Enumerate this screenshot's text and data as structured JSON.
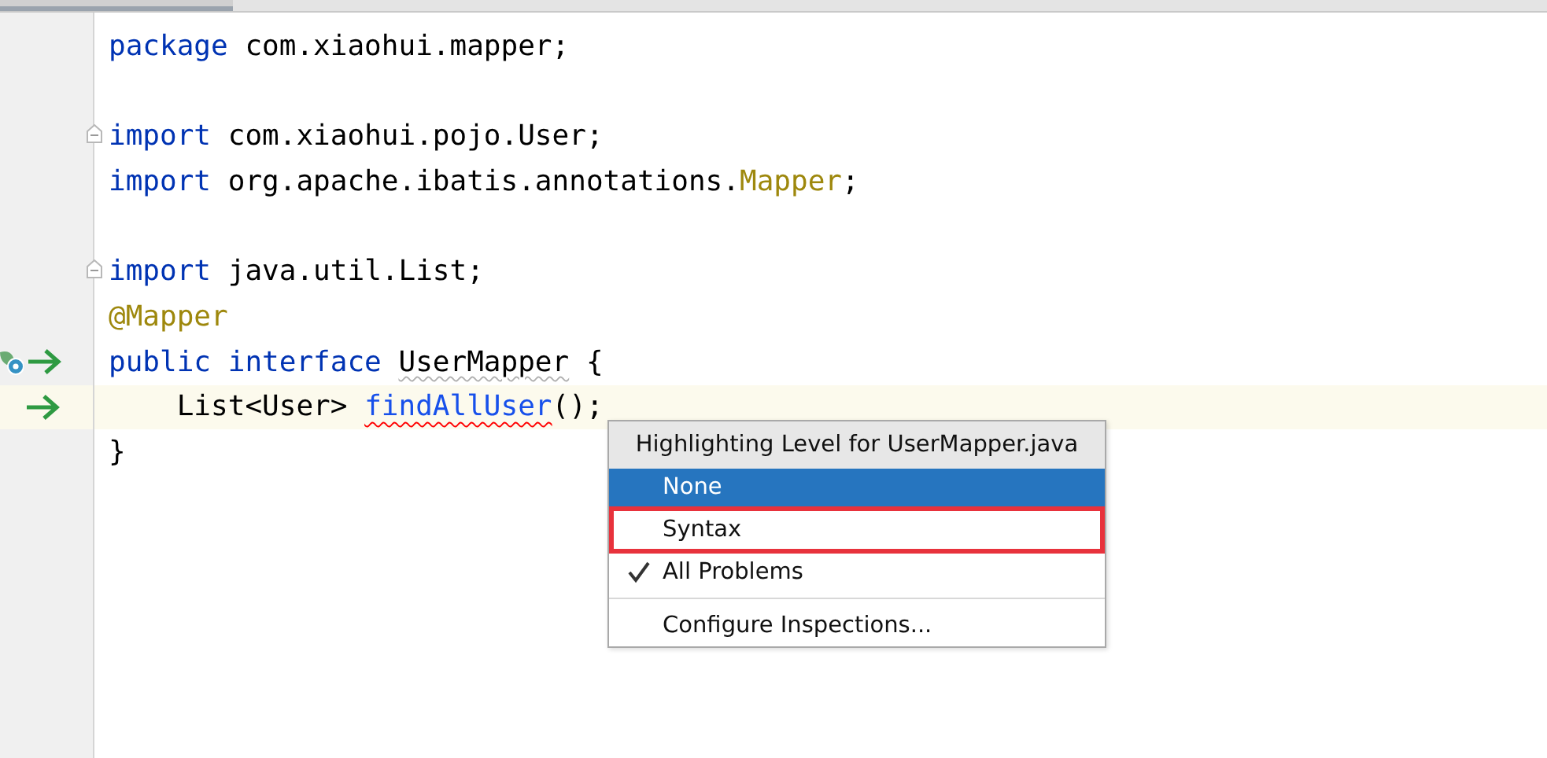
{
  "editor": {
    "lines": [
      {
        "tokens": [
          {
            "kind": "keyword",
            "text": "package"
          },
          {
            "kind": "plain",
            "text": " com.xiaohui.mapper;"
          }
        ]
      },
      {
        "space_before": true,
        "fold": true,
        "tokens": [
          {
            "kind": "keyword",
            "text": "import"
          },
          {
            "kind": "plain",
            "text": " com.xiaohui.pojo.User;"
          }
        ]
      },
      {
        "tokens": [
          {
            "kind": "keyword",
            "text": "import"
          },
          {
            "kind": "plain",
            "text": " org.apache.ibatis.annotations."
          },
          {
            "kind": "annotation",
            "text": "Mapper"
          },
          {
            "kind": "plain",
            "text": ";"
          }
        ]
      },
      {
        "space_before": true,
        "fold": true,
        "tokens": [
          {
            "kind": "keyword",
            "text": "import"
          },
          {
            "kind": "plain",
            "text": " java.util.List;"
          }
        ]
      },
      {
        "tokens": [
          {
            "kind": "annotation",
            "text": "@Mapper"
          }
        ]
      },
      {
        "bean": true,
        "arrow": true,
        "tokens": [
          {
            "kind": "keyword",
            "text": "public "
          },
          {
            "kind": "keyword",
            "text": "interface "
          },
          {
            "kind": "warning",
            "text": "UserMapper"
          },
          {
            "kind": "plain",
            "text": " {"
          }
        ]
      },
      {
        "bean": false,
        "arrow": true,
        "current": true,
        "tokens": [
          {
            "kind": "plain",
            "text": "    List<User> "
          },
          {
            "kind": "error",
            "text": "findAllUser"
          },
          {
            "kind": "plain",
            "text": "();"
          }
        ]
      },
      {
        "tokens": [
          {
            "kind": "plain",
            "text": "}"
          }
        ]
      }
    ]
  },
  "popup": {
    "items": [
      {
        "kind": "header",
        "label": "Highlighting Level for UserMapper.java"
      },
      {
        "kind": "item",
        "label": "None",
        "selected": true,
        "checked": false,
        "marked": false
      },
      {
        "kind": "item",
        "label": "Syntax",
        "selected": false,
        "checked": false,
        "marked": true
      },
      {
        "kind": "item",
        "label": "All Problems",
        "selected": false,
        "checked": true,
        "marked": false
      },
      {
        "kind": "separator"
      },
      {
        "kind": "item",
        "label": "Configure Inspections...",
        "selected": false,
        "checked": false,
        "marked": false
      }
    ]
  }
}
